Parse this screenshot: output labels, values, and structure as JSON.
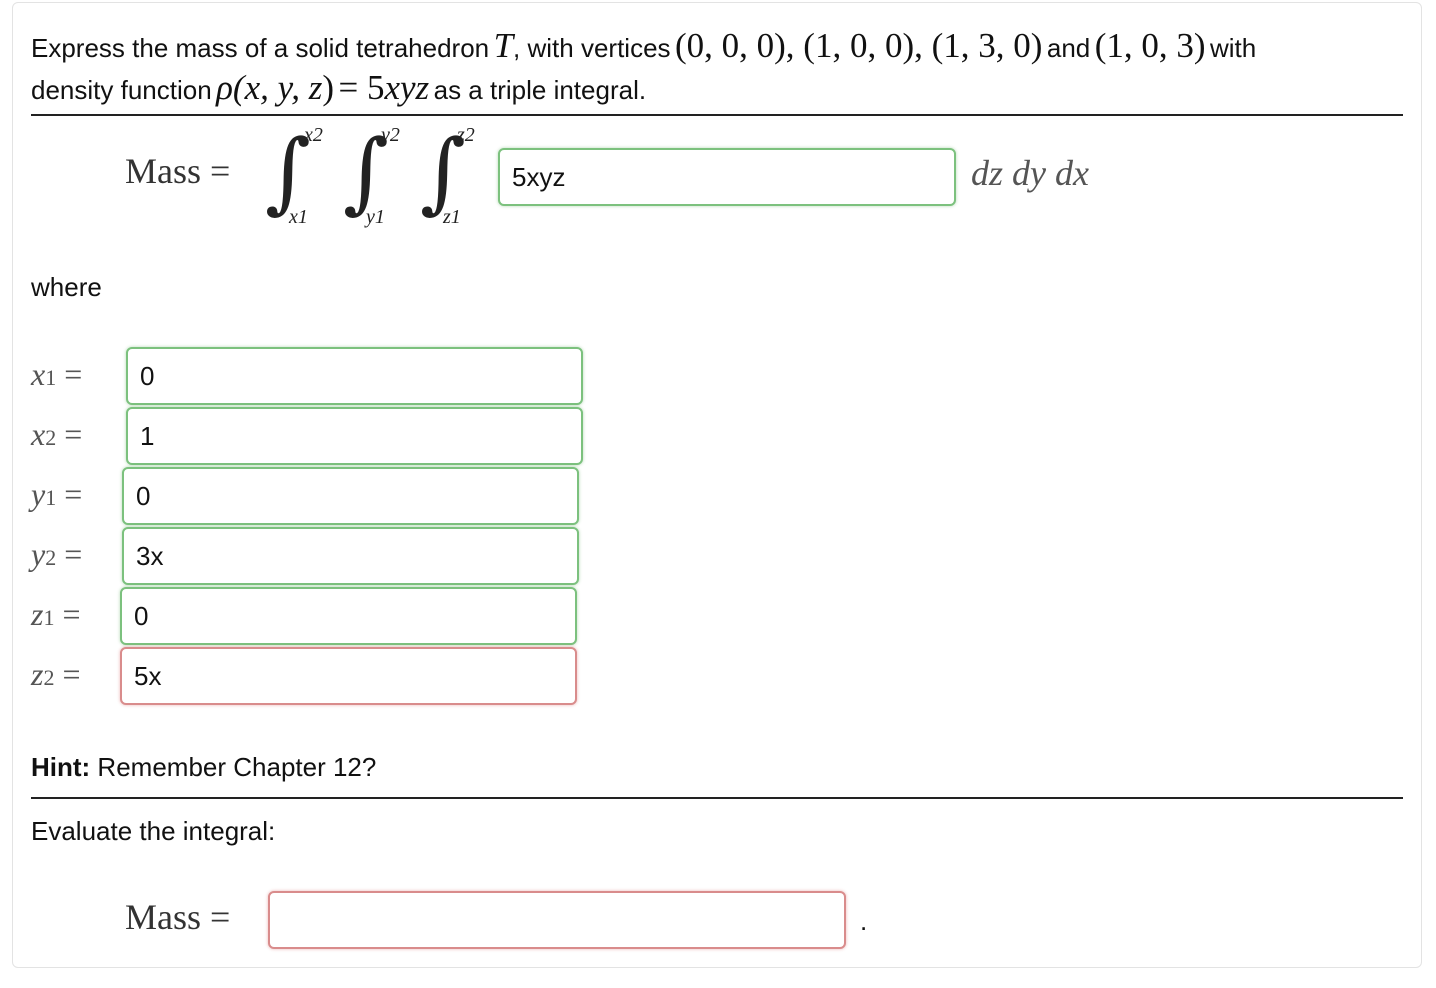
{
  "problem": {
    "intro": "Express the mass of a solid tetrahedron",
    "solid_symbol": "T",
    "with_vertices": ", with vertices",
    "v1": "(0, 0, 0), (1, 0, 0), (1, 3, 0)",
    "and": "and",
    "v4": "(1, 0, 3)",
    "with": "with",
    "density_label": "density function",
    "rho": "ρ(",
    "rho_args": "x, y, z",
    "rho_close": ")",
    "rho_eq": "= 5",
    "rho_vars": "xyz",
    "tail": "as a triple integral."
  },
  "integral": {
    "lhs": "Mass =",
    "upper": [
      "x2",
      "y2",
      "z2"
    ],
    "lower": [
      "x1",
      "y1",
      "z1"
    ],
    "integrand_value": "5xyz",
    "differentials": "dz dy dx"
  },
  "where_label": "where",
  "limits": [
    {
      "var": "x",
      "sub": "1",
      "value": "0",
      "status": "correct"
    },
    {
      "var": "x",
      "sub": "2",
      "value": "1",
      "status": "correct"
    },
    {
      "var": "y",
      "sub": "1",
      "value": "0",
      "status": "correct"
    },
    {
      "var": "y",
      "sub": "2",
      "value": "3x",
      "status": "correct"
    },
    {
      "var": "z",
      "sub": "1",
      "value": "0",
      "status": "correct"
    },
    {
      "var": "z",
      "sub": "2",
      "value": "5x",
      "status": "incorrect"
    }
  ],
  "hint": {
    "bold": "Hint:",
    "text": " Remember Chapter 12?"
  },
  "evaluate_label": "Evaluate the integral:",
  "answer": {
    "lhs": "Mass =",
    "value": "",
    "period": "."
  },
  "colors": {
    "correct": "#7cc17e",
    "incorrect": "#d98c8c",
    "rule": "#222222"
  }
}
